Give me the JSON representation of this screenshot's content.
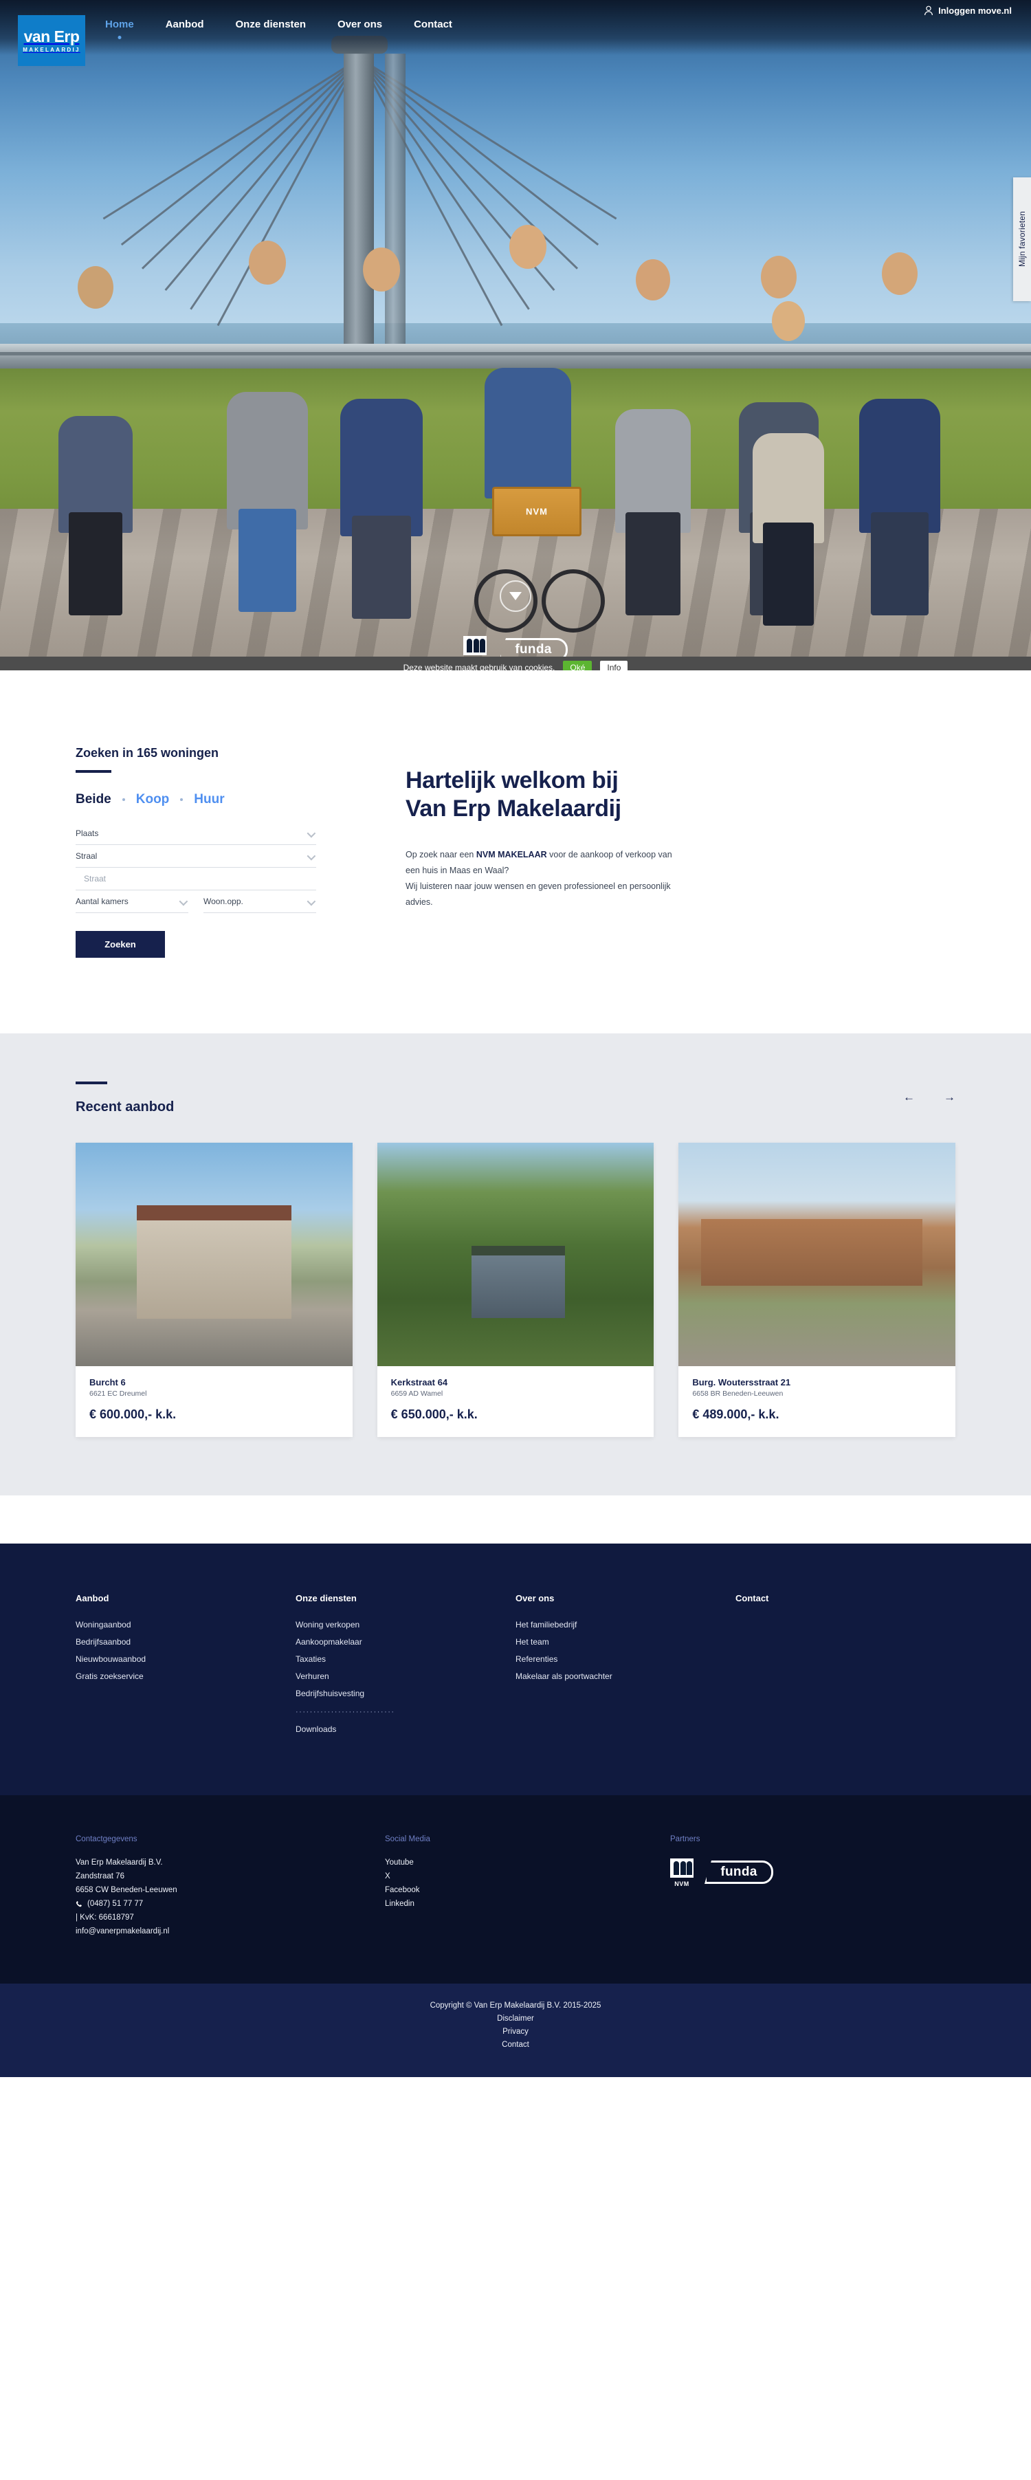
{
  "header": {
    "logo": {
      "line1": "van Erp",
      "line2": "MAKELAARDIJ"
    },
    "nav": [
      {
        "label": "Home",
        "active": true
      },
      {
        "label": "Aanbod",
        "active": false
      },
      {
        "label": "Onze diensten",
        "active": false
      },
      {
        "label": "Over ons",
        "active": false
      },
      {
        "label": "Contact",
        "active": false
      }
    ],
    "login_label": "Inloggen move.nl",
    "favorites_tab": "Mijn favorieten"
  },
  "hero": {
    "badges": [
      {
        "name": "NVM",
        "label": "NVM"
      },
      {
        "name": "funda",
        "label": "funda"
      }
    ]
  },
  "cookiebar": {
    "text": "Deze website maakt gebruik van cookies.",
    "accept_label": "Oké",
    "info_label": "Info"
  },
  "search": {
    "title": "Zoeken in 165 woningen",
    "tabs": [
      {
        "label": "Beide",
        "active": true
      },
      {
        "label": "Koop",
        "active": false
      },
      {
        "label": "Huur",
        "active": false
      }
    ],
    "fields": {
      "plaats": "Plaats",
      "straal": "Straal",
      "straat_placeholder": "Straat",
      "aantal_kamers": "Aantal kamers",
      "woon_opp": "Woon.opp."
    },
    "button_label": "Zoeken"
  },
  "welcome": {
    "title_line1": "Hartelijk welkom bij",
    "title_line2": "Van Erp Makelaardij",
    "body_pre": "Op zoek naar een ",
    "body_bold": "NVM MAKELAAR",
    "body_post": " voor de aankoop of verkoop van een huis in Maas en Waal?",
    "body_line2": "Wij luisteren naar jouw wensen en geven professioneel en persoonlijk advies."
  },
  "aanbod": {
    "title": "Recent aanbod",
    "prev_label": "←",
    "next_label": "→",
    "cards": [
      {
        "street": "Burcht 6",
        "zip": "6621 EC Dreumel",
        "price": "€ 600.000,- k.k."
      },
      {
        "street": "Kerkstraat 64",
        "zip": "6659 AD Wamel",
        "price": "€ 650.000,- k.k."
      },
      {
        "street": "Burg. Woutersstraat 21",
        "zip": "6658 BR Beneden-Leeuwen",
        "price": "€ 489.000,- k.k."
      }
    ]
  },
  "footer": {
    "columns": [
      {
        "title": "Aanbod",
        "links": [
          "Woningaanbod",
          "Bedrijfsaanbod",
          "Nieuwbouwaanbod",
          "Gratis zoekservice"
        ],
        "divider": false,
        "extra_links": []
      },
      {
        "title": "Onze diensten",
        "links": [
          "Woning verkopen",
          "Aankoopmakelaar",
          "Taxaties",
          "Verhuren",
          "Bedrijfshuisvesting"
        ],
        "divider": true,
        "divider_text": "····························",
        "extra_links": [
          "Downloads"
        ]
      },
      {
        "title": "Over ons",
        "links": [
          "Het familiebedrijf",
          "Het team",
          "Referenties",
          "Makelaar als poortwachter"
        ],
        "divider": false,
        "extra_links": []
      },
      {
        "title": "Contact",
        "links": [],
        "divider": false,
        "extra_links": []
      }
    ],
    "contact": {
      "heading": "Contactgegevens",
      "company": "Van Erp Makelaardij B.V.",
      "street": "Zandstraat 76",
      "city": "6658 CW Beneden-Leeuwen",
      "phone": "(0487) 51 77 77",
      "kvk": "| KvK: 66618797",
      "email": "info@vanerpmakelaardij.nl"
    },
    "social": {
      "heading": "Social Media",
      "links": [
        "Youtube",
        "X",
        "Facebook",
        "Linkedin"
      ]
    },
    "partners": {
      "heading": "Partners",
      "items": [
        "NVM",
        "funda"
      ]
    },
    "bottom": {
      "copyright": "Copyright © Van Erp Makelaardij B.V. 2015-2025",
      "links": [
        "Disclaimer",
        "Privacy",
        "Contact"
      ]
    }
  },
  "colors": {
    "brand_blue": "#0f7dc9",
    "navy": "#16214d",
    "deep_navy": "#101a3f",
    "darkest": "#0a1128",
    "accent_link": "#4f8ff0",
    "cookie_green": "#5cb531"
  }
}
